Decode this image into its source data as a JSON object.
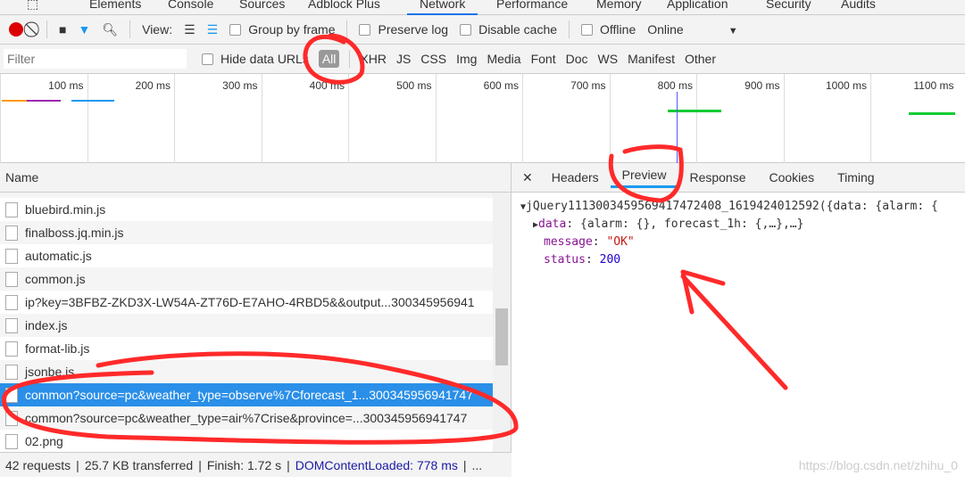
{
  "tabs": [
    "Elements",
    "Console",
    "Sources",
    "Adblock Plus",
    "Network",
    "Performance",
    "Memory",
    "Application",
    "Security",
    "Audits"
  ],
  "active_tab": "Network",
  "toolbar": {
    "view_label": "View:",
    "group_by_frame": "Group by frame",
    "preserve_log": "Preserve log",
    "disable_cache": "Disable cache",
    "offline": "Offline",
    "throttle": "Online"
  },
  "filterbar": {
    "placeholder": "Filter",
    "hide_data_urls": "Hide data URLs",
    "types": [
      "All",
      "XHR",
      "JS",
      "CSS",
      "Img",
      "Media",
      "Font",
      "Doc",
      "WS",
      "Manifest",
      "Other"
    ]
  },
  "timeline": [
    "100 ms",
    "200 ms",
    "300 ms",
    "400 ms",
    "500 ms",
    "600 ms",
    "700 ms",
    "800 ms",
    "900 ms",
    "1000 ms",
    "1100 ms"
  ],
  "requests": {
    "header": "Name",
    "rows": [
      "bluebird.min.js",
      "finalboss.jq.min.js",
      "automatic.js",
      "common.js",
      "ip?key=3BFBZ-ZKD3X-LW54A-ZT76D-E7AHO-4RBD5&&output...300345956941",
      "index.js",
      "format-lib.js",
      "jsonbe.js",
      "common?source=pc&weather_type=observe%7Cforecast_1...300345956941747",
      "common?source=pc&weather_type=air%7Crise&province=...300345956941747",
      "02.png"
    ],
    "selected_index": 8
  },
  "footer": {
    "requests": "42 requests",
    "transferred": "25.7 KB transferred",
    "finish": "Finish: 1.72 s",
    "dcl": "DOMContentLoaded: 778 ms",
    "more": "..."
  },
  "detail": {
    "tabs": [
      "Headers",
      "Preview",
      "Response",
      "Cookies",
      "Timing"
    ],
    "active": "Preview",
    "root": "jQuery111300345956941747​2408_1619424012592({data: {alarm: {",
    "data_key": "data",
    "data_val": "{alarm: {}, forecast_1h: {,…},…}",
    "message_key": "message",
    "message_val": "\"OK\"",
    "status_key": "status",
    "status_val": "200"
  },
  "watermark": "https://blog.csdn.net/zhihu_0",
  "colors": {
    "accent": "#1a73e8",
    "selected_row": "#2a8fe8",
    "annotation": "#ff2a2a"
  }
}
